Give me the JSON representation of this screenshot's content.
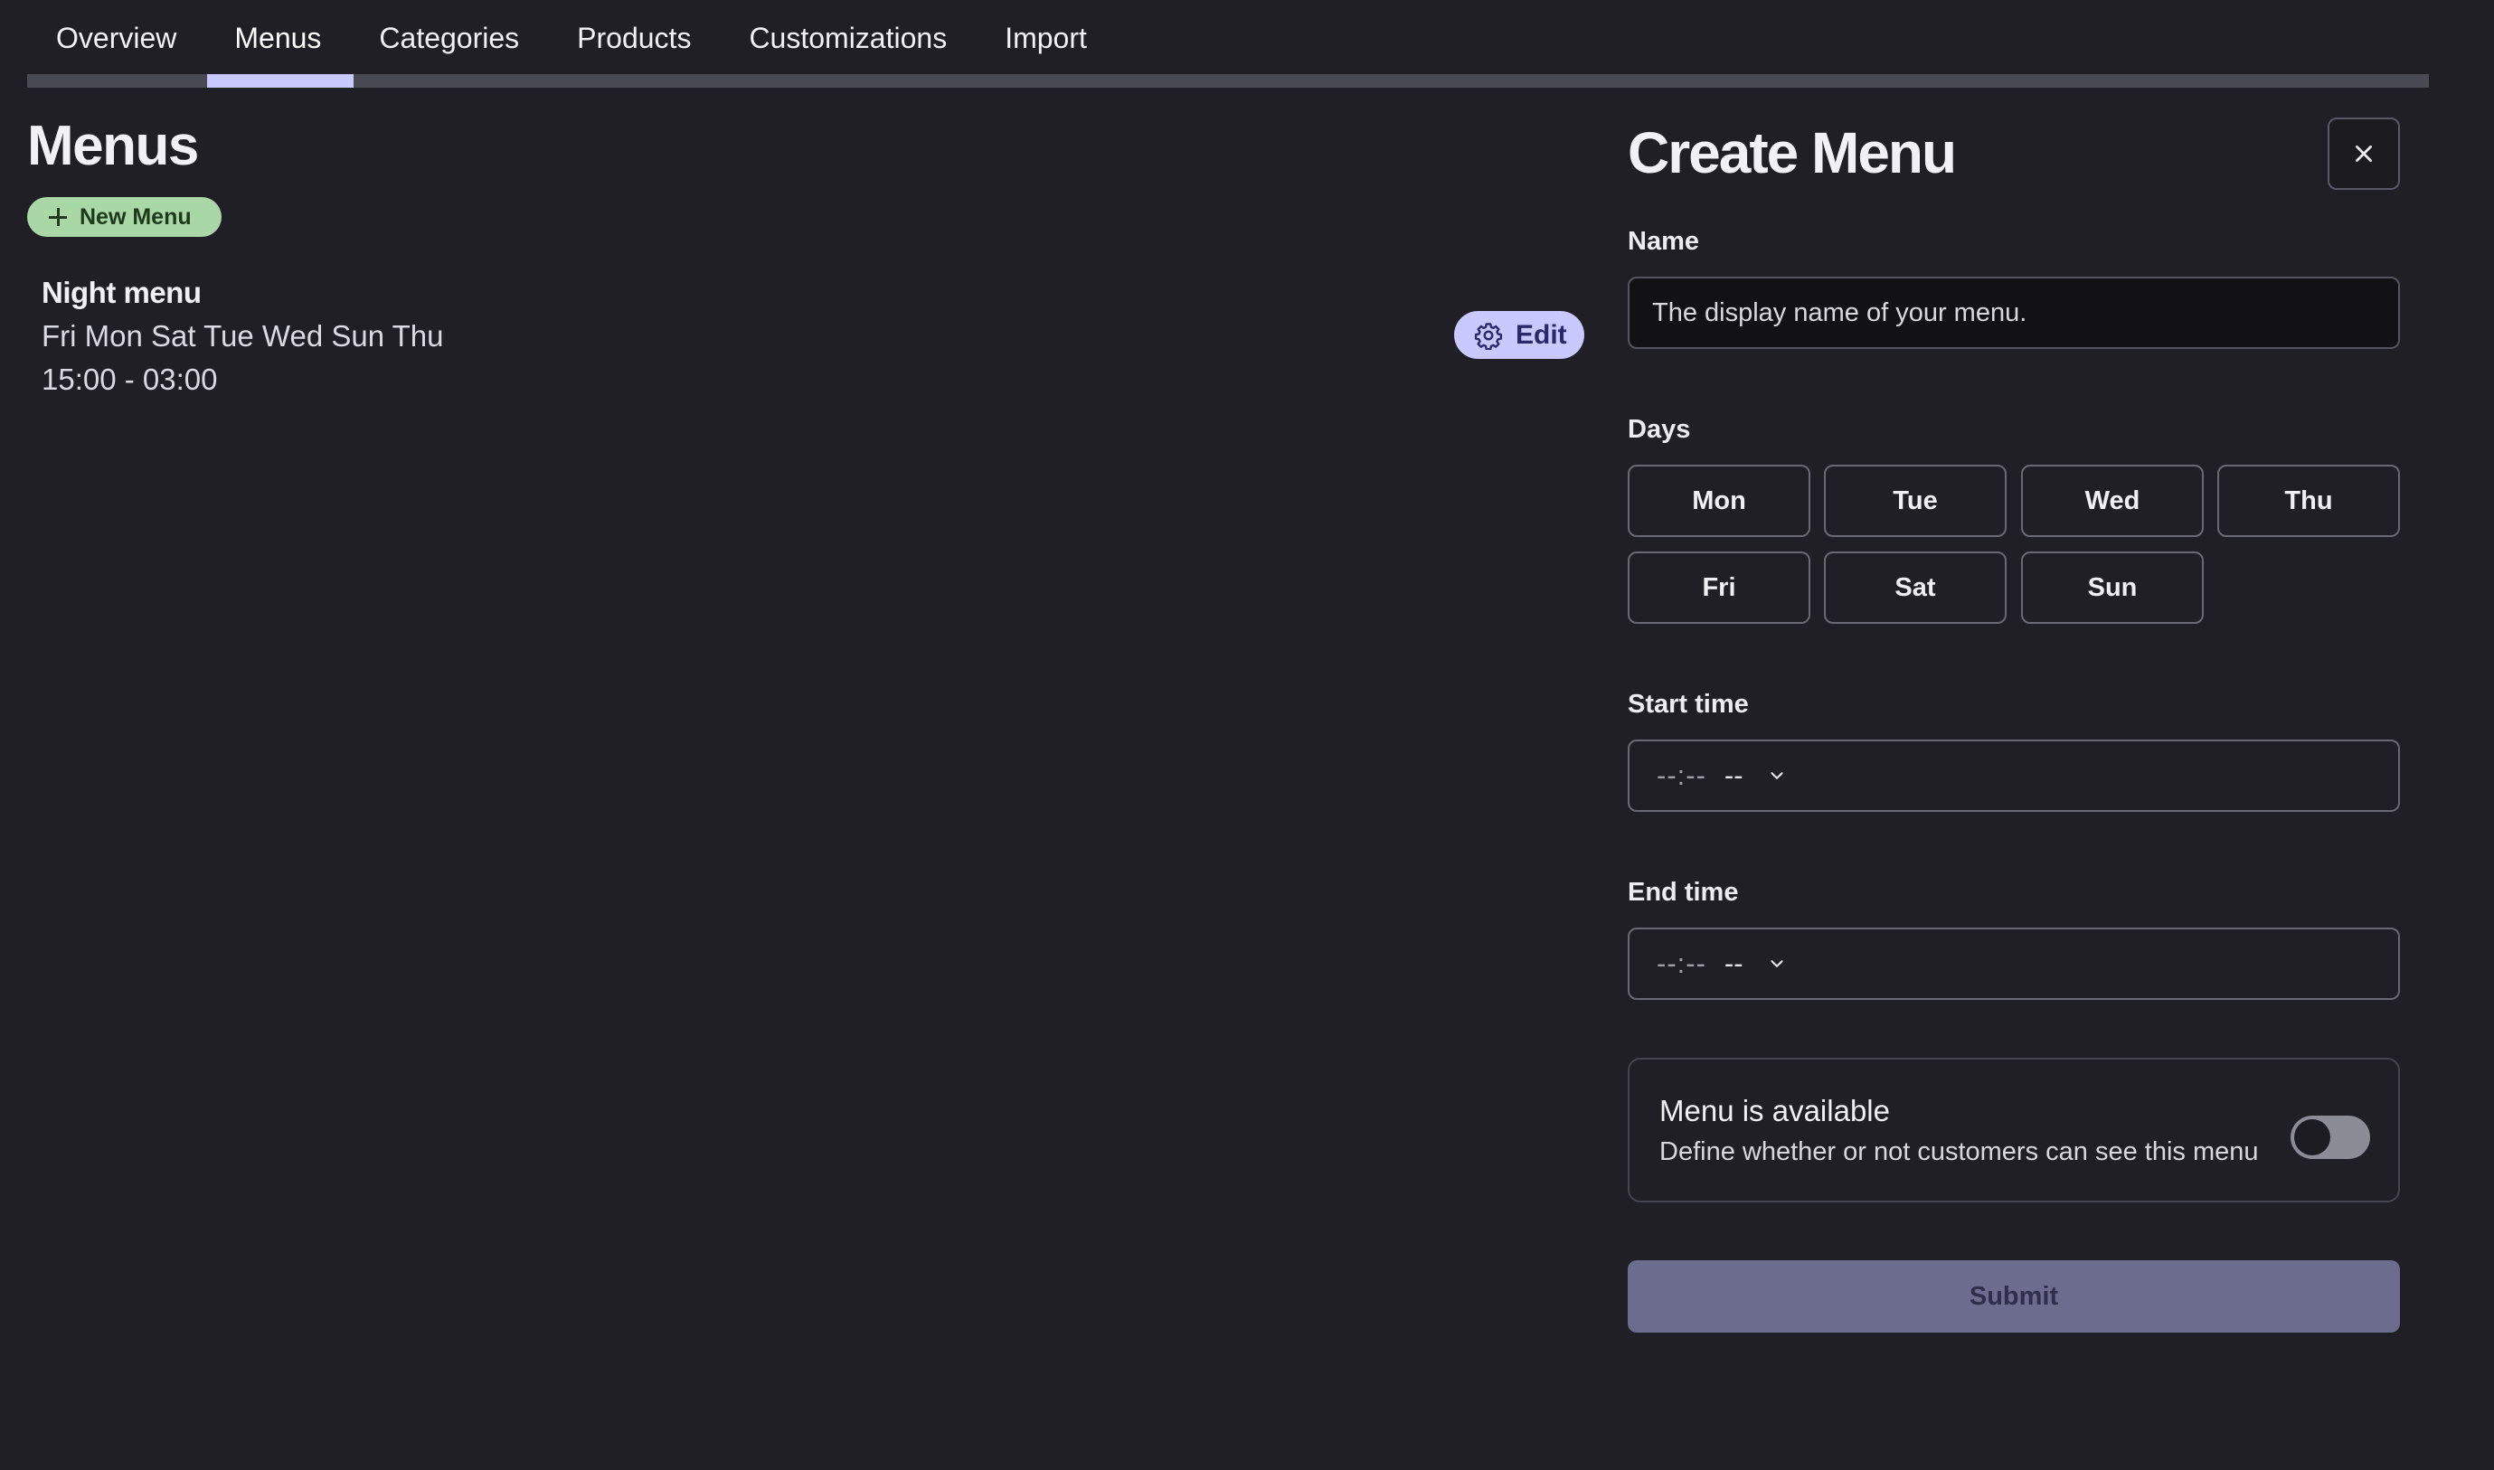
{
  "nav": {
    "tabs": [
      "Overview",
      "Menus",
      "Categories",
      "Products",
      "Customizations",
      "Import"
    ],
    "active": "Menus"
  },
  "menus": {
    "title": "Menus",
    "new_button": "New Menu",
    "items": [
      {
        "name": "Night menu",
        "days": "Fri Mon Sat Tue Wed Sun Thu",
        "hours": "15:00 - 03:00",
        "edit_label": "Edit"
      }
    ]
  },
  "form": {
    "title": "Create Menu",
    "name_label": "Name",
    "name_placeholder": "The display name of your menu.",
    "name_value": "",
    "days_label": "Days",
    "days": [
      "Mon",
      "Tue",
      "Wed",
      "Thu",
      "Fri",
      "Sat",
      "Sun"
    ],
    "start_label": "Start time",
    "start_placeholder": "--:--",
    "start_ampm": "--",
    "end_label": "End time",
    "end_placeholder": "--:--",
    "end_ampm": "--",
    "available_title": "Menu is available",
    "available_desc": "Define whether or not customers can see this menu",
    "available_on": false,
    "submit_label": "Submit"
  },
  "colors": {
    "background": "#1f1f25",
    "accent": "#c9c8ff",
    "new_button": "#a9d8a6",
    "submit_disabled": "#6c6c8e"
  },
  "icons": {
    "new_menu": "plus-icon",
    "edit": "gear-icon",
    "close": "close-icon",
    "time_dropdown": "chevron-down-icon"
  }
}
